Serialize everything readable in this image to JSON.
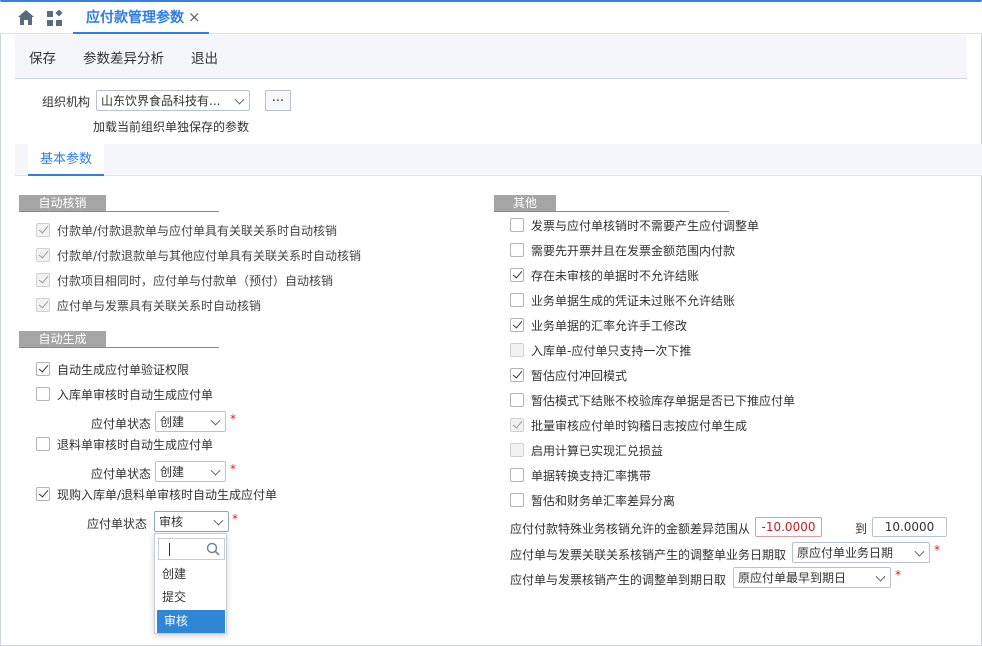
{
  "tab": {
    "title": "应付款管理参数",
    "close": "×"
  },
  "toolbar": {
    "save": "保存",
    "diff": "参数差异分析",
    "exit": "退出"
  },
  "org": {
    "label": "组织机构",
    "value": "山东饮界食品科技有...",
    "more": "...",
    "note": "加载当前组织单独保存的参数"
  },
  "basic_tab": "基本参数",
  "auto_verify": {
    "title": "自动核销",
    "items": [
      "付款单/付款退款单与应付单具有关联关系时自动核销",
      "付款单/付款退款单与其他应付单具有关联关系时自动核销",
      "付款项目相同时，应付单与付款单（预付）自动核销",
      "应付单与发票具有关联关系时自动核销"
    ]
  },
  "auto_gen": {
    "title": "自动生成",
    "item1": "自动生成应付单验证权限",
    "item2": "入库单审核时自动生成应付单",
    "status_label": "应付单状态",
    "status2": "创建",
    "item3": "退料单审核时自动生成应付单",
    "status3": "创建",
    "item4": "现购入库单/退料单审核时自动生成应付单",
    "status4": "审核",
    "star": "*",
    "options": [
      "创建",
      "提交",
      "审核"
    ]
  },
  "other": {
    "title": "其他",
    "items": [
      "发票与应付单核销时不需要产生应付调整单",
      "需要先开票并且在发票金额范围内付款",
      "存在未审核的单据时不允许结账",
      "业务单据生成的凭证未过账不允许结账",
      "业务单据的汇率允许手工修改",
      "入库单-应付单只支持一次下推",
      "暂估应付冲回模式",
      "暂估模式下结账不校验库存单据是否已下推应付单",
      "批量审核应付单时钩稽日志按应付单生成",
      "启用计算已实现汇兑损益",
      "单据转换支持汇率携带",
      "暂估和财务单汇率差异分离"
    ],
    "range_label": "应付付款特殊业务核销允许的金额差异范围从",
    "range_from": "-10.0000",
    "range_to_label": "到",
    "range_to": "10.0000",
    "adj_date_label": "应付单与发票关联关系核销产生的调整单业务日期取",
    "adj_date_value": "原应付单业务日期",
    "due_date_label": "应付单与发票核销产生的调整单到期日取",
    "due_date_value": "原应付单最早到期日"
  }
}
